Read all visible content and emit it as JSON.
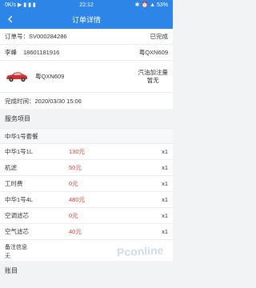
{
  "status_bar": {
    "left_text": "0K/s ▶ ▮ ▮ ▮",
    "time": "22:12",
    "right_text": "✱ ⏰ ▲ 53%"
  },
  "nav": {
    "title": "订单详情"
  },
  "order": {
    "number_label": "订单号：",
    "number": "SV000284286",
    "status": "已完成",
    "customer_name": "李峰",
    "customer_phone": "18601181916",
    "plate_right": "粤QXN609",
    "vehicle_plate": "粤QXN609",
    "fuel_label": "汽油加注量",
    "fuel_value": "暂无",
    "completed_label": "完成时间：",
    "completed_time": "2020/03/30 15:06"
  },
  "services": {
    "section_title": "服务项目",
    "package_name": "中华1号套餐",
    "items": [
      {
        "name": "中华1号1L",
        "price": "130元",
        "qty": "x1"
      },
      {
        "name": "机滤",
        "price": "50元",
        "qty": "x1"
      },
      {
        "name": "工时费",
        "price": "0元",
        "qty": "x1"
      },
      {
        "name": "中华1号4L",
        "price": "480元",
        "qty": "x1"
      },
      {
        "name": "空调滤芯",
        "price": "0元",
        "qty": "x1"
      },
      {
        "name": "空气滤芯",
        "price": "40元",
        "qty": "x1"
      }
    ]
  },
  "remark": {
    "title": "备注信息",
    "value": "无"
  },
  "billing": {
    "section_title": "账目"
  },
  "watermark": "Pconline",
  "colors": {
    "brand": "#2e85e8",
    "price": "#e53935"
  }
}
